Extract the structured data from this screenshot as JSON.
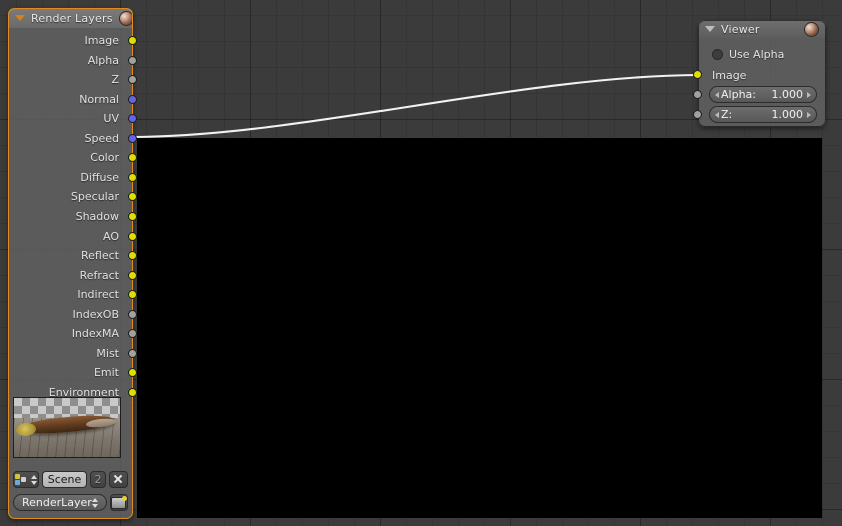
{
  "editor": {
    "name": "blender-node-editor",
    "background_color": "#3b3b3b",
    "grid_color": "#333333",
    "backdrop_color": "#000000"
  },
  "render_layers_node": {
    "title": "Render Layers",
    "collapse_icon": "triangle-down-icon",
    "header_icon": "render-result-icon",
    "outputs": [
      {
        "label": "Image",
        "type": "color"
      },
      {
        "label": "Alpha",
        "type": "value"
      },
      {
        "label": "Z",
        "type": "value"
      },
      {
        "label": "Normal",
        "type": "vector"
      },
      {
        "label": "UV",
        "type": "vector"
      },
      {
        "label": "Speed",
        "type": "vector"
      },
      {
        "label": "Color",
        "type": "color"
      },
      {
        "label": "Diffuse",
        "type": "color"
      },
      {
        "label": "Specular",
        "type": "color"
      },
      {
        "label": "Shadow",
        "type": "color"
      },
      {
        "label": "AO",
        "type": "color"
      },
      {
        "label": "Reflect",
        "type": "color"
      },
      {
        "label": "Refract",
        "type": "color"
      },
      {
        "label": "Indirect",
        "type": "color"
      },
      {
        "label": "IndexOB",
        "type": "value"
      },
      {
        "label": "IndexMA",
        "type": "value"
      },
      {
        "label": "Mist",
        "type": "value"
      },
      {
        "label": "Emit",
        "type": "color"
      },
      {
        "label": "Environment",
        "type": "color"
      }
    ],
    "preview": {
      "name": "render-preview-thumbnail",
      "description": "rendered wooden log on planks over alpha checker"
    },
    "scene_row": {
      "browse_icon": "browse-scene-icon",
      "scene_name": "Scene",
      "users_count": "2",
      "unlink_icon": "unlink-x-icon"
    },
    "layer_row": {
      "layer_name": "RenderLayer",
      "select_icon": "updown-arrows-icon",
      "render_icon": "render-layer-icon"
    }
  },
  "viewer_node": {
    "title": "Viewer",
    "collapse_icon": "triangle-down-icon",
    "header_icon": "viewer-image-icon",
    "use_alpha": {
      "label": "Use Alpha",
      "checked": false
    },
    "inputs": [
      {
        "label": "Image",
        "type": "color",
        "value": null
      },
      {
        "label": "Alpha:",
        "type": "value",
        "value": "1.000"
      },
      {
        "label": "Z:",
        "type": "value",
        "value": "1.000"
      }
    ]
  },
  "link": {
    "from": "Speed",
    "to": "Image",
    "color": "#ffffff"
  },
  "socket_colors": {
    "color": "#dede00",
    "value": "#a1a1a1",
    "vector": "#6363e8"
  }
}
